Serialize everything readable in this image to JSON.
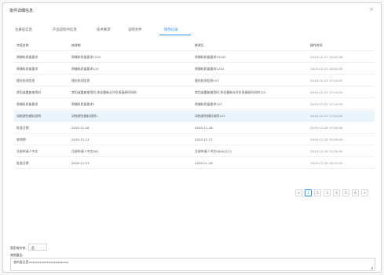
{
  "dialog": {
    "title": "批件详细信息",
    "close": "×"
  },
  "tabs": [
    {
      "label": "注册证信息",
      "active": false
    },
    {
      "label": "产品说明书信息",
      "active": false
    },
    {
      "label": "技术要求",
      "active": false
    },
    {
      "label": "证明文件",
      "active": false
    },
    {
      "label": "修改记录",
      "active": true
    }
  ],
  "table": {
    "headers": [
      "字段名称",
      "修改前",
      "修改后",
      "操作时间"
    ],
    "rows": [
      [
        "原辅料质量要求",
        "原辅料质量要求1234",
        "原辅料质量要求12345",
        "2019-12-23 18:02:46"
      ],
      [
        "原辅料质量要求",
        "原辅料质量要求123",
        "原辅料质量要求1234",
        "2019-12-23 18:02:35"
      ],
      [
        "理化检测信息",
        "理化检测信息",
        "理化检测信息123",
        "2019-12-23 17:24:55"
      ],
      [
        "禁用或重复使用时",
        "禁用或重复使用时,净化重新允许负责接收时间的",
        "禁用或重复使用时,净化重新允许负责接收时间的123",
        "2019-12-23 17:24:55"
      ],
      [
        "原辅料质量要求",
        "原辅料质量要求1",
        "原辅料质量要求123",
        "2019-12-23 17:24:55"
      ],
      [
        "动物源性辅料说明",
        "动物源性辅料说明1",
        "动物源性辅料说明123",
        "2019-12-23 17:24:55"
      ],
      [
        "批准日期",
        "2019-11-16",
        "2019-11-16",
        "2019-12-18 15:50:40"
      ],
      [
        "有效期",
        "2019-12-14",
        "2019-12-13",
        "2019-12-18 15:50:40"
      ],
      [
        "注册申请人中文",
        "注册申请人中文001",
        "注册申请人中文00001122",
        "2019-12-18 15:50:40"
      ],
      [
        "批准日期",
        "2019-11-23",
        "2019-11-16",
        "2019-12-16 18:11:02"
      ]
    ],
    "selected_row": 5
  },
  "pagination": {
    "prev": "<",
    "pages": [
      "1",
      "2",
      "3",
      "4",
      "5",
      "6"
    ],
    "current": "1",
    "next": ">"
  },
  "footer": {
    "is_supplement_label": "是否有补充:",
    "is_supplement_value": "否",
    "remark_label": "其他意见:",
    "remark_value": "我的意见是xxxxxxxxxxxxxxxxxxxxxx"
  }
}
